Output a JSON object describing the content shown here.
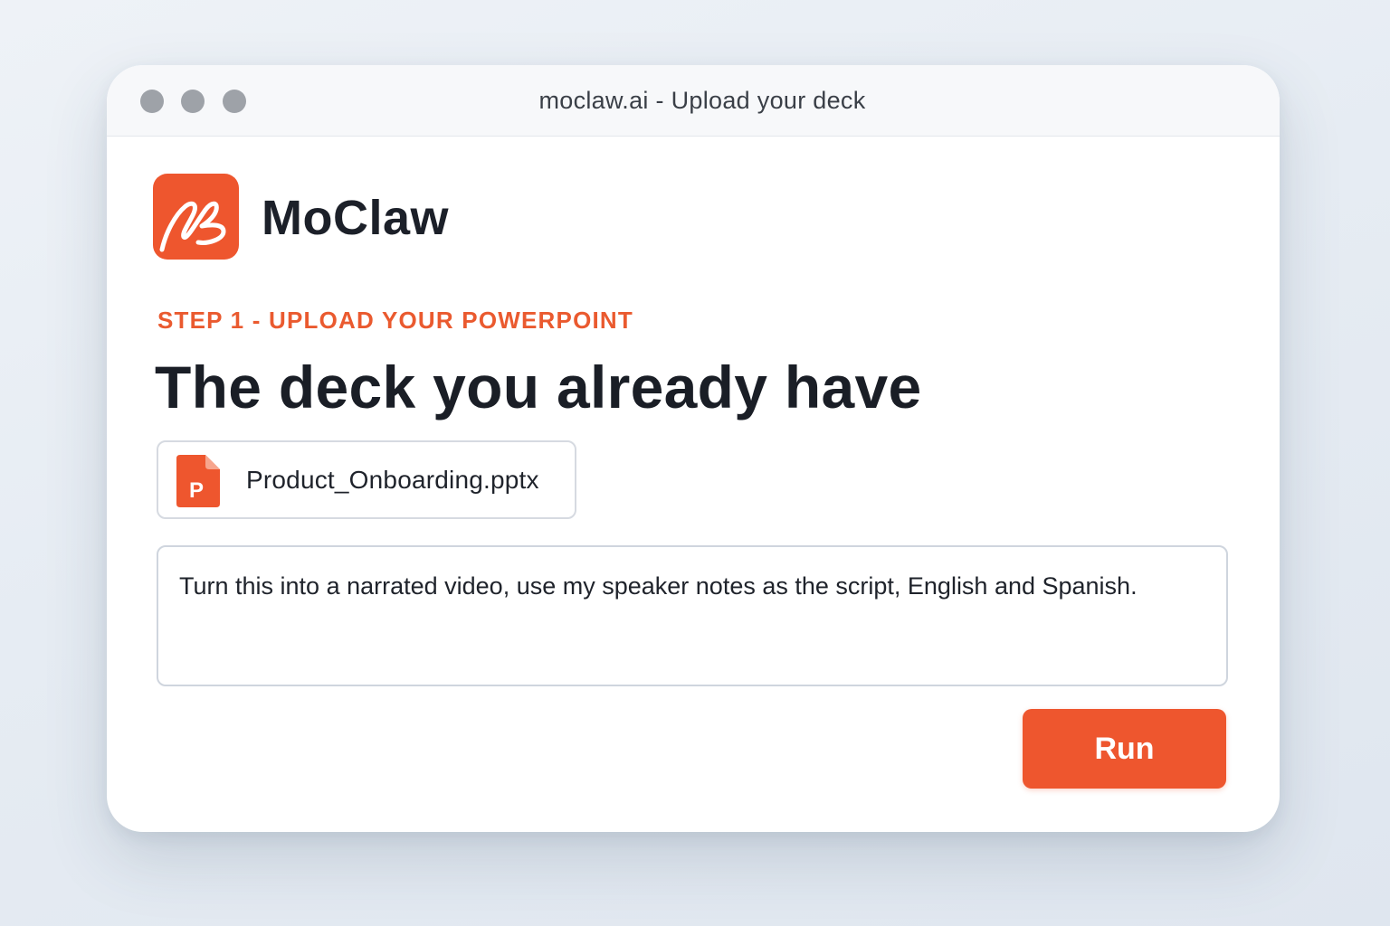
{
  "window": {
    "title": "moclaw.ai - Upload your deck",
    "controls": [
      "close-dot",
      "minimize-dot",
      "zoom-dot"
    ]
  },
  "brand": {
    "name": "MoClaw",
    "logo_icon": "signature-scribble-icon",
    "accent_color": "#ee562e"
  },
  "step": {
    "label": "STEP 1 - UPLOAD YOUR POWERPOINT"
  },
  "main": {
    "headline": "The deck you already have",
    "file": {
      "name": "Product_Onboarding.pptx",
      "icon": "powerpoint-file-icon",
      "icon_letter": "P"
    },
    "prompt": {
      "value": "Turn this into a narrated video, use my speaker notes as the script, English and Spanish."
    },
    "run_label": "Run"
  }
}
